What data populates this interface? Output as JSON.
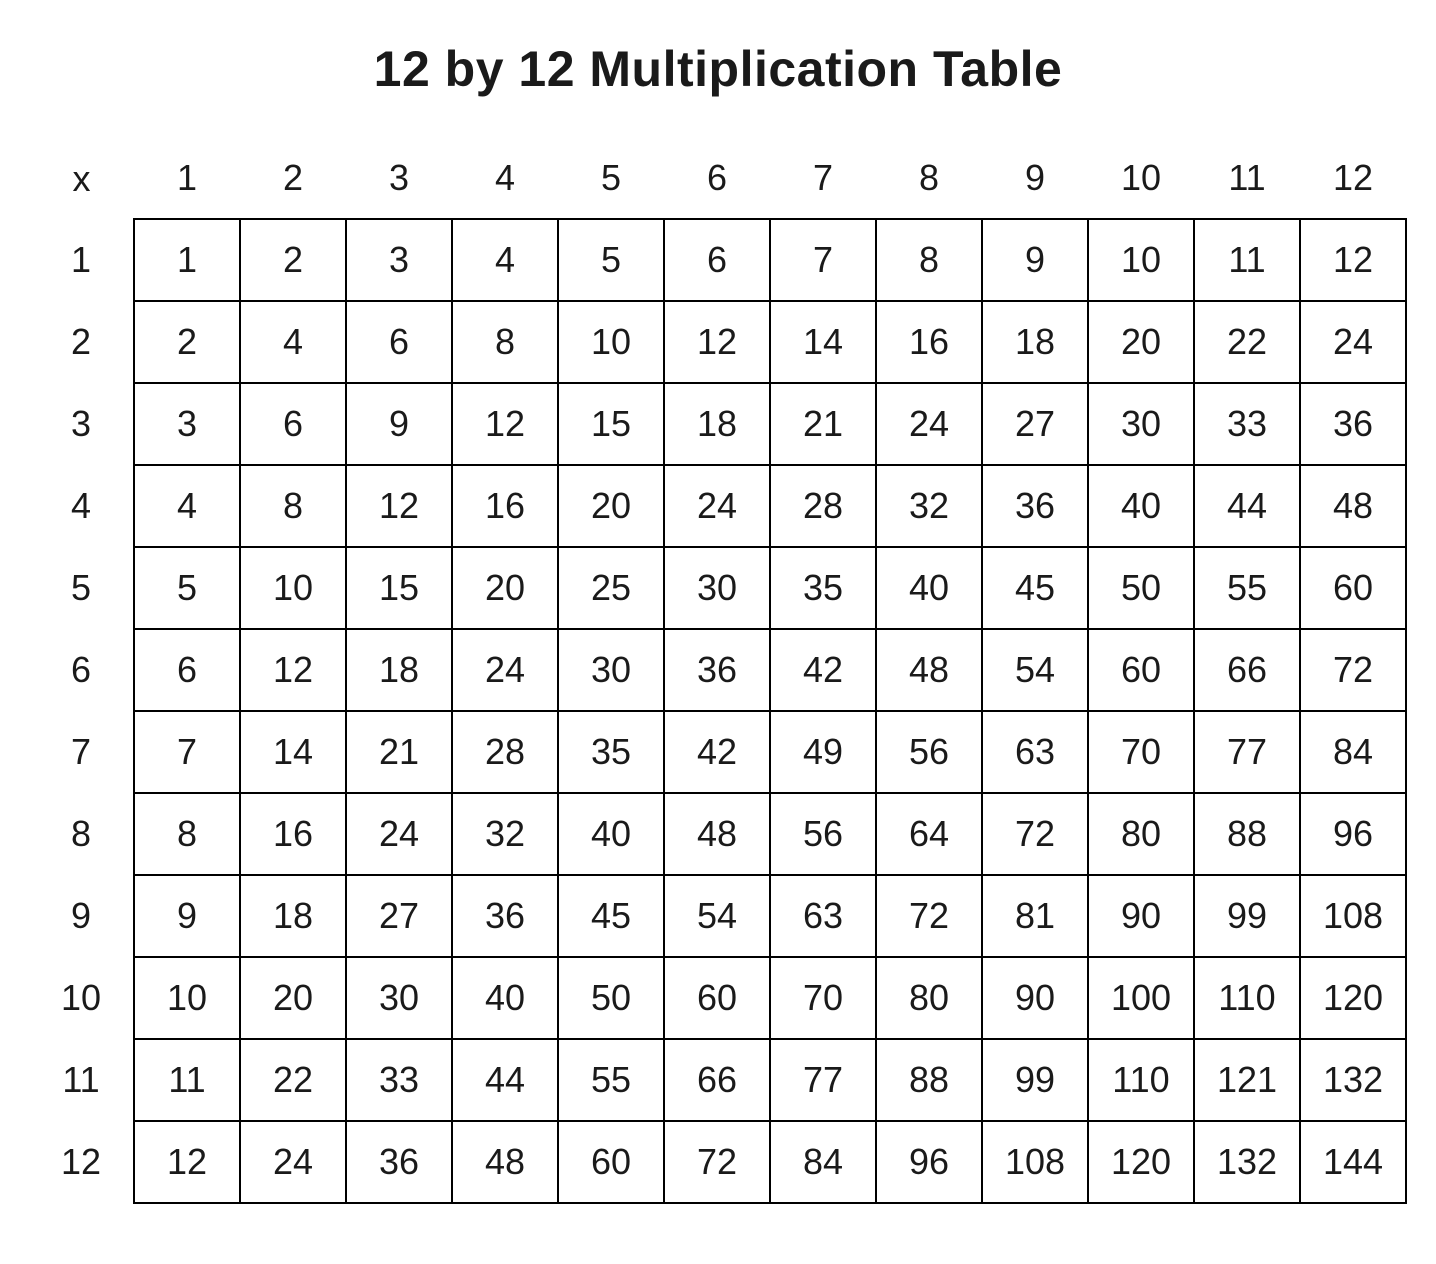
{
  "title": "12 by 12 Multiplication Table",
  "corner_label": "x",
  "col_headers": [
    1,
    2,
    3,
    4,
    5,
    6,
    7,
    8,
    9,
    10,
    11,
    12
  ],
  "row_headers": [
    1,
    2,
    3,
    4,
    5,
    6,
    7,
    8,
    9,
    10,
    11,
    12
  ],
  "rows": [
    [
      1,
      2,
      3,
      4,
      5,
      6,
      7,
      8,
      9,
      10,
      11,
      12
    ],
    [
      2,
      4,
      6,
      8,
      10,
      12,
      14,
      16,
      18,
      20,
      22,
      24
    ],
    [
      3,
      6,
      9,
      12,
      15,
      18,
      21,
      24,
      27,
      30,
      33,
      36
    ],
    [
      4,
      8,
      12,
      16,
      20,
      24,
      28,
      32,
      36,
      40,
      44,
      48
    ],
    [
      5,
      10,
      15,
      20,
      25,
      30,
      35,
      40,
      45,
      50,
      55,
      60
    ],
    [
      6,
      12,
      18,
      24,
      30,
      36,
      42,
      48,
      54,
      60,
      66,
      72
    ],
    [
      7,
      14,
      21,
      28,
      35,
      42,
      49,
      56,
      63,
      70,
      77,
      84
    ],
    [
      8,
      16,
      24,
      32,
      40,
      48,
      56,
      64,
      72,
      80,
      88,
      96
    ],
    [
      9,
      18,
      27,
      36,
      45,
      54,
      63,
      72,
      81,
      90,
      99,
      108
    ],
    [
      10,
      20,
      30,
      40,
      50,
      60,
      70,
      80,
      90,
      100,
      110,
      120
    ],
    [
      11,
      22,
      33,
      44,
      55,
      66,
      77,
      88,
      99,
      110,
      121,
      132
    ],
    [
      12,
      24,
      36,
      48,
      60,
      72,
      84,
      96,
      108,
      120,
      132,
      144
    ]
  ],
  "chart_data": {
    "type": "table",
    "title": "12 by 12 Multiplication Table",
    "columns": [
      1,
      2,
      3,
      4,
      5,
      6,
      7,
      8,
      9,
      10,
      11,
      12
    ],
    "rows_label": [
      1,
      2,
      3,
      4,
      5,
      6,
      7,
      8,
      9,
      10,
      11,
      12
    ],
    "values": [
      [
        1,
        2,
        3,
        4,
        5,
        6,
        7,
        8,
        9,
        10,
        11,
        12
      ],
      [
        2,
        4,
        6,
        8,
        10,
        12,
        14,
        16,
        18,
        20,
        22,
        24
      ],
      [
        3,
        6,
        9,
        12,
        15,
        18,
        21,
        24,
        27,
        30,
        33,
        36
      ],
      [
        4,
        8,
        12,
        16,
        20,
        24,
        28,
        32,
        36,
        40,
        44,
        48
      ],
      [
        5,
        10,
        15,
        20,
        25,
        30,
        35,
        40,
        45,
        50,
        55,
        60
      ],
      [
        6,
        12,
        18,
        24,
        30,
        36,
        42,
        48,
        54,
        60,
        66,
        72
      ],
      [
        7,
        14,
        21,
        28,
        35,
        42,
        49,
        56,
        63,
        70,
        77,
        84
      ],
      [
        8,
        16,
        24,
        32,
        40,
        48,
        56,
        64,
        72,
        80,
        88,
        96
      ],
      [
        9,
        18,
        27,
        36,
        45,
        54,
        63,
        72,
        81,
        90,
        99,
        108
      ],
      [
        10,
        20,
        30,
        40,
        50,
        60,
        70,
        80,
        90,
        100,
        110,
        120
      ],
      [
        11,
        22,
        33,
        44,
        55,
        66,
        77,
        88,
        99,
        110,
        121,
        132
      ],
      [
        12,
        24,
        36,
        48,
        60,
        72,
        84,
        96,
        108,
        120,
        132,
        144
      ]
    ]
  }
}
